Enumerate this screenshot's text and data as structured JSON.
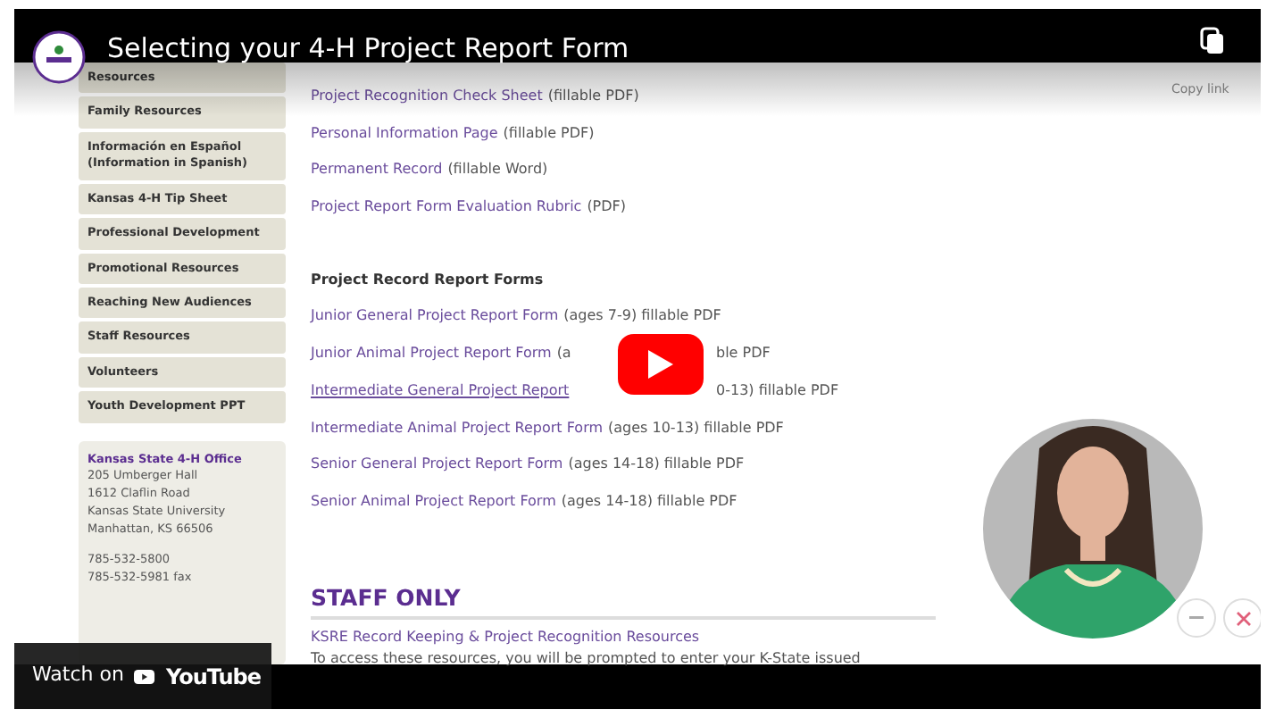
{
  "video": {
    "title": "Selecting your 4-H Project Report Form",
    "copy_link": "Copy link",
    "watch_on": "Watch on",
    "youtube": "YouTube"
  },
  "sidebar": {
    "items": [
      "Resources",
      "Family Resources",
      "Información en Español (Information in Spanish)",
      "Kansas 4-H Tip Sheet",
      "Professional Development",
      "Promotional Resources",
      "Reaching New Audiences",
      "Staff Resources",
      "Volunteers",
      "Youth Development PPT"
    ]
  },
  "office": {
    "title": "Kansas State 4-H Office",
    "address": [
      "205 Umberger Hall",
      "1612 Claflin Road",
      "Kansas State University",
      "Manhattan, KS 66506"
    ],
    "phones": [
      "785-532-5800",
      "785-532-5981 fax"
    ]
  },
  "content": {
    "links": [
      {
        "link": "Project Recognition Check Sheet",
        "note": "(fillable PDF)"
      },
      {
        "link": "Personal Information Page",
        "note": "(fillable PDF)"
      },
      {
        "link": "Permanent Record",
        "note": "(fillable Word)"
      },
      {
        "link": "Project Report Form Evaluation Rubric",
        "note": "(PDF)"
      }
    ],
    "forms_heading": "Project Record Report Forms",
    "forms": [
      {
        "link": "Junior General Project Report Form",
        "note": "(ages 7-9) fillable PDF",
        "hovered": false
      },
      {
        "link": "Junior Animal Project Report Form",
        "note": "(a",
        "after": "ble PDF",
        "hovered": false
      },
      {
        "link": "Intermediate General Project Report",
        "after": "0-13) fillable PDF",
        "hovered": true
      },
      {
        "link": "Intermediate Animal Project Report Form",
        "note": "(ages 10-13) fillable PDF",
        "hovered": false
      },
      {
        "link": "Senior General Project Report Form",
        "note": "(ages 14-18) fillable PDF",
        "hovered": false
      },
      {
        "link": "Senior Animal Project Report Form",
        "note": "(ages 14-18) fillable PDF",
        "hovered": false
      }
    ],
    "staff_heading": "STAFF ONLY",
    "staff_link": "KSRE Record Keeping & Project Recognition Resources",
    "staff_text": "To access these resources, you will be prompted to enter your K-State issued"
  }
}
